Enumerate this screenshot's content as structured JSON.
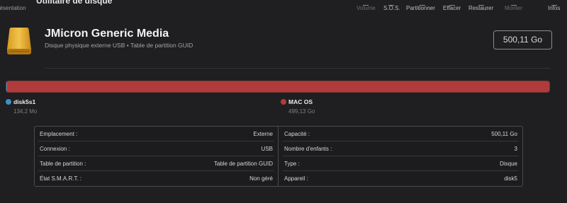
{
  "toolbar": {
    "view_label": "résentation",
    "app_title": "Utilitaire de disque",
    "items": [
      {
        "label": "Volume",
        "enabled": false
      },
      {
        "label": "S.O.S.",
        "enabled": true
      },
      {
        "label": "Partitionner",
        "enabled": true
      },
      {
        "label": "Effacer",
        "enabled": true
      },
      {
        "label": "Restaurer",
        "enabled": true
      },
      {
        "label": "Monter",
        "enabled": false
      },
      {
        "label": "Infos",
        "enabled": true
      }
    ]
  },
  "header": {
    "disk_name": "JMicron Generic Media",
    "disk_description": "Disque physique externe USB • Table de partition GUID",
    "capacity": "500,11 Go",
    "icon": "external-drive-icon"
  },
  "partitions": [
    {
      "name": "disk5s1",
      "size": "134,2 Mo",
      "color": "#3f8fc7",
      "fraction": 0.0003
    },
    {
      "name": "MAC OS",
      "size": "499,13 Go",
      "color": "#b13b3b",
      "fraction": 0.9997
    }
  ],
  "info": {
    "left": [
      {
        "key": "Emplacement :",
        "value": "Externe"
      },
      {
        "key": "Connexion :",
        "value": "USB"
      },
      {
        "key": "Table de partition :",
        "value": "Table de partition GUID"
      },
      {
        "key": "État S.M.A.R.T. :",
        "value": "Non géré"
      }
    ],
    "right": [
      {
        "key": "Capacité :",
        "value": "500,11 Go"
      },
      {
        "key": "Nombre d'enfants :",
        "value": "3"
      },
      {
        "key": "Type :",
        "value": "Disque"
      },
      {
        "key": "Appareil :",
        "value": "disk5"
      }
    ]
  }
}
